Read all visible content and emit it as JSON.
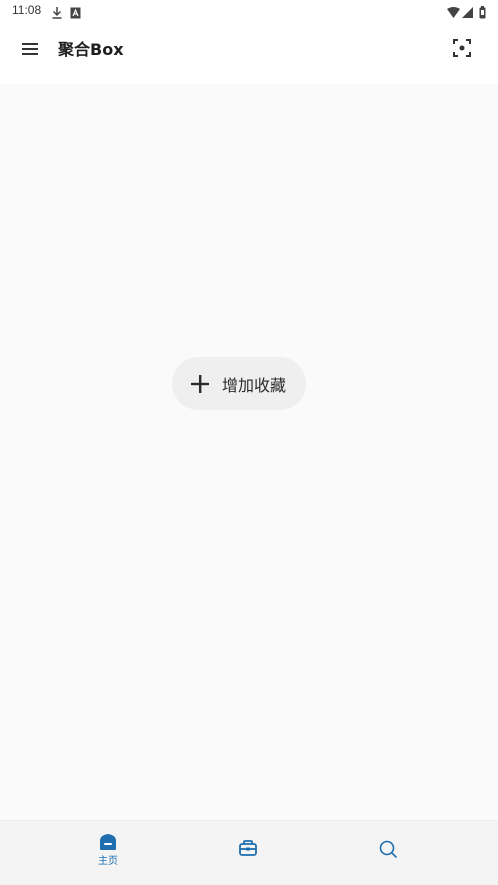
{
  "status_bar": {
    "time": "11:08",
    "icons": [
      "download-icon",
      "a-box-icon",
      "wifi-icon",
      "signal-icon",
      "battery-icon"
    ]
  },
  "app_bar": {
    "title": "聚合Box",
    "icons": [
      "menu-icon",
      "scan-icon"
    ]
  },
  "main": {
    "add_button_label": "增加收藏"
  },
  "bottom_nav": {
    "items": [
      {
        "label": "主页",
        "icon": "home-icon",
        "active": true
      },
      {
        "label": "",
        "icon": "toolbox-icon",
        "active": false
      },
      {
        "label": "",
        "icon": "search-icon",
        "active": false
      }
    ]
  },
  "colors": {
    "accent": "#1f6fb0",
    "background": "#fafafa",
    "button_bg": "#efefef",
    "nav_bg": "#f4f4f4"
  }
}
